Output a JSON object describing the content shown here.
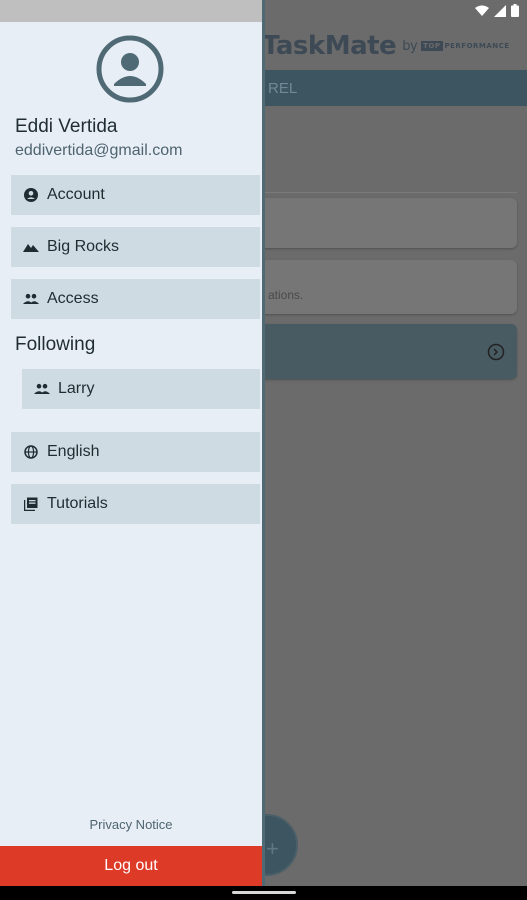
{
  "app": {
    "title_part1": "Task",
    "title_part2": "Mate",
    "title_by": "by",
    "brand_tag": "TOP",
    "brand_text": "PERFORMANCE",
    "tab_label": "REL",
    "card2_text": "ations."
  },
  "drawer": {
    "user_name": "Eddi Vertida",
    "user_email": "eddivertida@gmail.com",
    "menu": [
      {
        "label": "Account",
        "icon": "account-circle-icon"
      },
      {
        "label": "Big Rocks",
        "icon": "mountain-icon"
      },
      {
        "label": "Access",
        "icon": "people-icon"
      }
    ],
    "following_heading": "Following",
    "following": [
      {
        "label": "Larry",
        "icon": "people-icon"
      }
    ],
    "settings": [
      {
        "label": "English",
        "icon": "globe-icon"
      },
      {
        "label": "Tutorials",
        "icon": "library-books-icon"
      }
    ],
    "privacy_label": "Privacy Notice",
    "logout_label": "Log out"
  },
  "colors": {
    "drawer_bg": "#e8eef5",
    "menu_item_bg": "#cfdbe2",
    "logout_bg": "#de3a28",
    "scrim": "#6b6b6b",
    "accent": "#4f6a75"
  }
}
